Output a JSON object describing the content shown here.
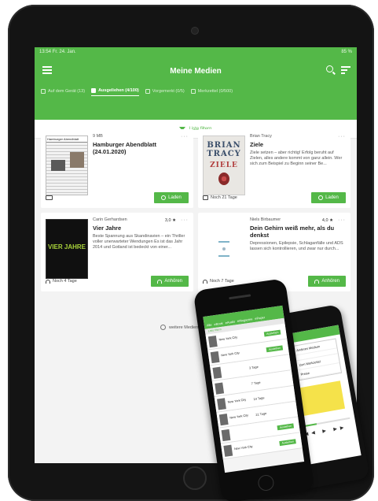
{
  "status": {
    "time": "13:54",
    "date": "Fr. 24. Jan.",
    "battery": "85 %"
  },
  "header": {
    "title": "Meine Medien"
  },
  "tabs": [
    {
      "label": "Auf dem Gerät (13)"
    },
    {
      "label": "Ausgeliehen (4/100)"
    },
    {
      "label": "Vorgemerkt (0/5)"
    },
    {
      "label": "Merkzettel (0/500)"
    }
  ],
  "filter": {
    "label": "Liste filtern"
  },
  "cards": [
    {
      "meta": "9 MB",
      "rating": "",
      "title": "Hamburger Abendblatt (24.01.2020)",
      "description": "",
      "footer": "",
      "button": "Laden"
    },
    {
      "meta": "Brian Tracy",
      "rating": "",
      "title": "Ziele",
      "description": "Ziele setzen – aber richtig! Erfolg beruht auf Zielen, alles andere kommt von ganz allein. Wer sich zum Beispiel zu Beginn seiner Be...",
      "footer": "Noch 21 Tage",
      "button": "Laden"
    },
    {
      "meta": "Carin Gerhardsen",
      "rating": "3,0 ★",
      "title": "Vier Jahre",
      "description": "Beste Spannung aus Skandinavien – ein Thriller voller unerwarteter Wendungen Es ist das Jahr 2014 und Gotland ist bedeckt von einer...",
      "footer": "Noch 4 Tage",
      "button": "Anhören"
    },
    {
      "meta": "Niels Birbaumer",
      "rating": "4,0 ★",
      "title": "Dein Gehirn weiß mehr, als du denkst",
      "description": "Depressionen, Epilepsie, Schlaganfälle und ADS lassen sich kontrollieren, und zwar nur durch...",
      "footer": "Noch 7 Tage",
      "button": "Anhören"
    }
  ],
  "covers": {
    "paper_masthead": "Hamburger Abendblatt",
    "tracy_author": "BRIAN TRACY",
    "tracy_title": "ZIELE",
    "vier_title": "VIER JAHRE"
  },
  "more_media": {
    "label": "weitere Medien hi"
  },
  "phone": {
    "tabs": [
      "Alle",
      "eBook",
      "eAudio",
      "eMagazine",
      "ePaper"
    ],
    "filter": "Liste filtern",
    "rows": [
      {
        "title": "New York City",
        "sub": "",
        "days": "",
        "button": "Ausleihen"
      },
      {
        "title": "New York City",
        "sub": "",
        "days": "",
        "button": "Ausleihen"
      },
      {
        "title": "",
        "sub": "",
        "days": "3 Tage",
        "button": ""
      },
      {
        "title": "",
        "sub": "",
        "days": "7 Tage",
        "button": ""
      },
      {
        "title": "New York City",
        "sub": "",
        "days": "14 Tage",
        "button": ""
      },
      {
        "title": "New York City",
        "sub": "",
        "days": "21 Tage",
        "button": ""
      },
      {
        "title": "",
        "sub": "",
        "days": "",
        "button": "Ausleihen"
      },
      {
        "title": "New York City",
        "sub": "",
        "days": "",
        "button": "Ausleihen"
      }
    ]
  },
  "phone2": {
    "menu": [
      "Anderes Medium",
      "",
      "Zum Merkzettel",
      "Preise"
    ]
  }
}
